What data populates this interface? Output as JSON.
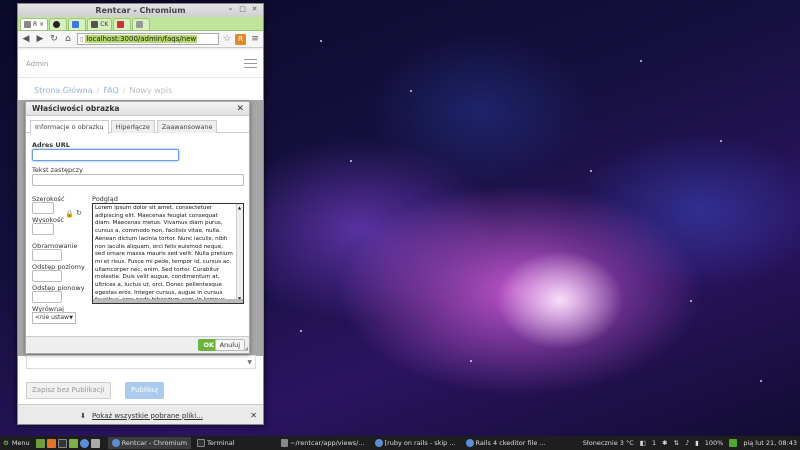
{
  "browser": {
    "window_title": "Rentcar - Chromium",
    "active_tab_label": "R",
    "tabs": [
      "github-tab",
      "google-tab",
      "ck-tab",
      "rails-tab",
      "tab"
    ],
    "tab_ck_label": "CK",
    "url": "localhost:3000/admin/faqs/new",
    "extension_label": "R"
  },
  "page": {
    "header_title": "Admin",
    "breadcrumb": [
      "Strona Główna",
      "FAQ",
      "Nowy wpis"
    ],
    "draft_button": "Zapisz bez Publikacji",
    "publish_button": "Publikuj",
    "download_bar_link": "Pokaż wszystkie pobrane pliki..."
  },
  "dialog": {
    "title": "Właściwości obrazka",
    "tabs": [
      "Informacje o obrazku",
      "Hiperłącze",
      "Zaawansowane"
    ],
    "url_label": "Adres URL",
    "url_value": "",
    "alt_label": "Tekst zastępczy",
    "width_label": "Szerokość",
    "height_label": "Wysokość",
    "border_label": "Obramowanie",
    "hspace_label": "Odstęp poziomy",
    "vspace_label": "Odstęp pionowy",
    "align_label": "Wyrównaj",
    "align_value": "<nie ustaw",
    "preview_label": "Podgląd",
    "preview_text": "Lorem ipsum dolor sit amet, consectetuer adipiscing elit. Maecenas feugiat consequat diam. Maecenas metus. Vivamus diam purus, cursus a, commodo non, facilisis vitae, nulla. Aenean dictum lacinia tortor. Nunc iaculis, nibh non iaculis aliquam, orci felis euismod neque, sed ornare massa mauris sed velit. Nulla pretium mi et risus. Fusce mi pede, tempor id, cursus ac, ullamcorper nec, enim. Sed tortor. Curabitur molestie. Duis velit augue, condimentum at, ultrices a, luctus ut, orci. Donec pellentesque egestas eros. Integer cursus, augue in cursus faucibus, eros pede bibendum sem, in tempus tellus justo quis ligula. Etiam eget tortor. Vestibulum rutrum, est ut placerat elementum",
    "ok_button": "OK",
    "cancel_button": "Anuluj"
  },
  "taskbar": {
    "menu_label": "Menu",
    "tasks": [
      "Rentcar - Chromium",
      "Terminal",
      "~/rentcar/app/views/...",
      "[ruby on rails - skip ...",
      "Rails 4 ckeditor file ..."
    ],
    "weather": "Słonecznie 3 °C",
    "page_indicator": "1",
    "battery": "100%",
    "datetime": "pią lut 21, 08:43"
  }
}
